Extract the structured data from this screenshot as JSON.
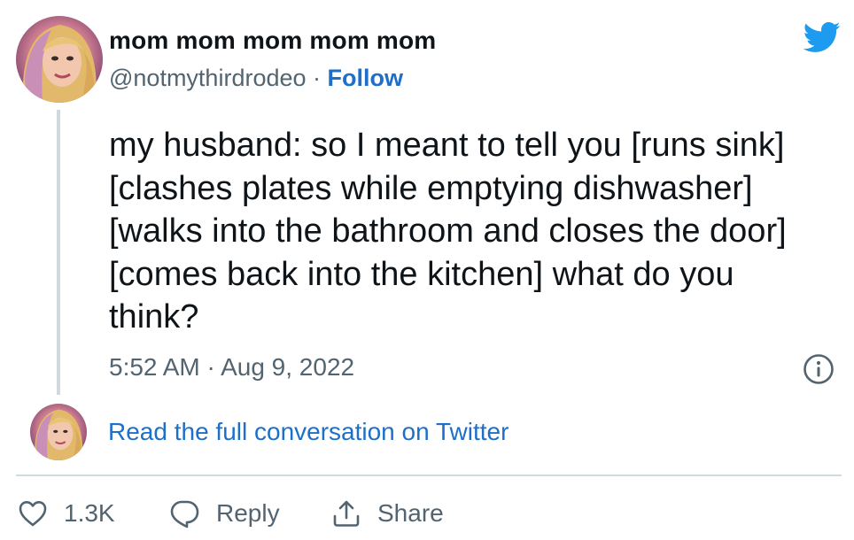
{
  "author": {
    "display_name": "mom mom mom mom mom",
    "handle": "@notmythirdrodeo",
    "separator": " · ",
    "follow_label": "Follow"
  },
  "tweet": {
    "text": "my husband: so I meant to tell you [runs sink] [clashes plates while emptying dishwasher] [walks into the bathroom and closes the door] [comes back into the kitchen] what do you think?",
    "timestamp": "5:52 AM · Aug 9, 2022"
  },
  "conversation_link": "Read the full conversation on Twitter",
  "actions": {
    "like_count": "1.3K",
    "reply_label": "Reply",
    "share_label": "Share"
  },
  "icons": {
    "brand": "twitter-bird-icon",
    "info": "info-icon",
    "like": "heart-icon",
    "reply": "speech-bubble-icon",
    "share": "share-upload-icon"
  },
  "colors": {
    "link": "#1d6fc9",
    "twitter_brand": "#1d9bf0",
    "muted_text": "#536471",
    "main_text": "#0f1419",
    "divider": "#cfd9de"
  }
}
